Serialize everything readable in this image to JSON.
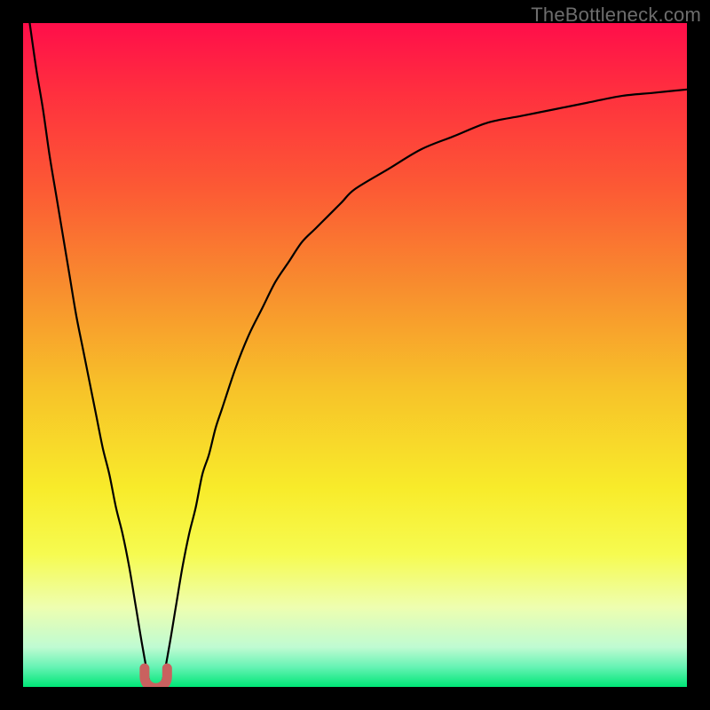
{
  "watermark": "TheBottleneck.com",
  "colors": {
    "frame": "#000000",
    "curve": "#000000",
    "marker_fill": "#C9615F",
    "gradient_stops": [
      {
        "offset": 0.0,
        "color": "#FF0E4A"
      },
      {
        "offset": 0.1,
        "color": "#FF2E3F"
      },
      {
        "offset": 0.25,
        "color": "#FC5A34"
      },
      {
        "offset": 0.4,
        "color": "#F88E2E"
      },
      {
        "offset": 0.55,
        "color": "#F7C229"
      },
      {
        "offset": 0.7,
        "color": "#F8EB2A"
      },
      {
        "offset": 0.8,
        "color": "#F6FB50"
      },
      {
        "offset": 0.88,
        "color": "#EEFEB0"
      },
      {
        "offset": 0.94,
        "color": "#BFFBD2"
      },
      {
        "offset": 0.97,
        "color": "#66F3B4"
      },
      {
        "offset": 1.0,
        "color": "#00E676"
      }
    ]
  },
  "chart_data": {
    "type": "line",
    "title": "",
    "xlabel": "",
    "ylabel": "",
    "xlim": [
      0,
      100
    ],
    "ylim": [
      0,
      100
    ],
    "x": [
      1,
      2,
      3,
      4,
      5,
      6,
      7,
      8,
      9,
      10,
      11,
      12,
      13,
      14,
      15,
      16,
      17,
      18,
      19,
      20,
      21,
      22,
      23,
      24,
      25,
      26,
      27,
      28,
      29,
      30,
      32,
      34,
      36,
      38,
      40,
      42,
      44,
      46,
      48,
      50,
      55,
      60,
      65,
      70,
      75,
      80,
      85,
      90,
      95,
      100
    ],
    "values": [
      100,
      93,
      87,
      80,
      74,
      68,
      62,
      56,
      51,
      46,
      41,
      36,
      32,
      27,
      23,
      18,
      12,
      6,
      1,
      0,
      1,
      6,
      12,
      18,
      23,
      27,
      32,
      35,
      39,
      42,
      48,
      53,
      57,
      61,
      64,
      67,
      69,
      71,
      73,
      75,
      78,
      81,
      83,
      85,
      86,
      87,
      88,
      89,
      89.5,
      90
    ],
    "marker": {
      "x_range": [
        18.3,
        21.7
      ],
      "y": 0,
      "segments": [
        {
          "cx": 19.0,
          "cy": 1.2
        },
        {
          "cx": 19.5,
          "cy": 0.0
        },
        {
          "cx": 20.5,
          "cy": 0.0
        },
        {
          "cx": 21.0,
          "cy": 1.2
        }
      ]
    }
  }
}
